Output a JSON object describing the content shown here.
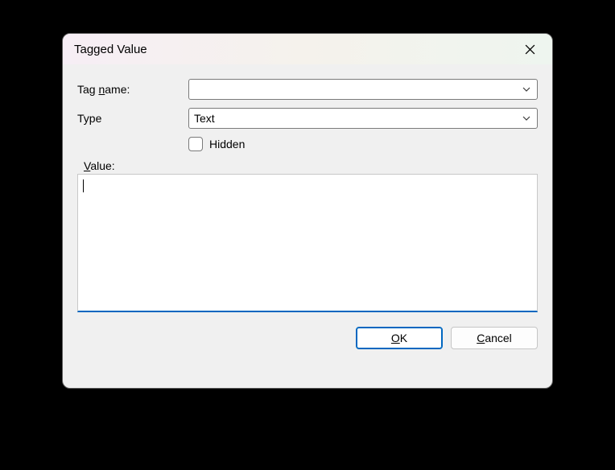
{
  "dialog": {
    "title": "Tagged Value"
  },
  "labels": {
    "tag_name_pre": "Tag ",
    "tag_name_mn": "n",
    "tag_name_post": "ame:",
    "type": "Type",
    "hidden": "Hidden",
    "value_mn": "V",
    "value_post": "alue:"
  },
  "fields": {
    "tag_name_value": "",
    "type_value": "Text",
    "hidden_checked": false,
    "value_text": ""
  },
  "buttons": {
    "ok_mn": "O",
    "ok_post": "K",
    "cancel_mn": "C",
    "cancel_post": "ancel"
  }
}
